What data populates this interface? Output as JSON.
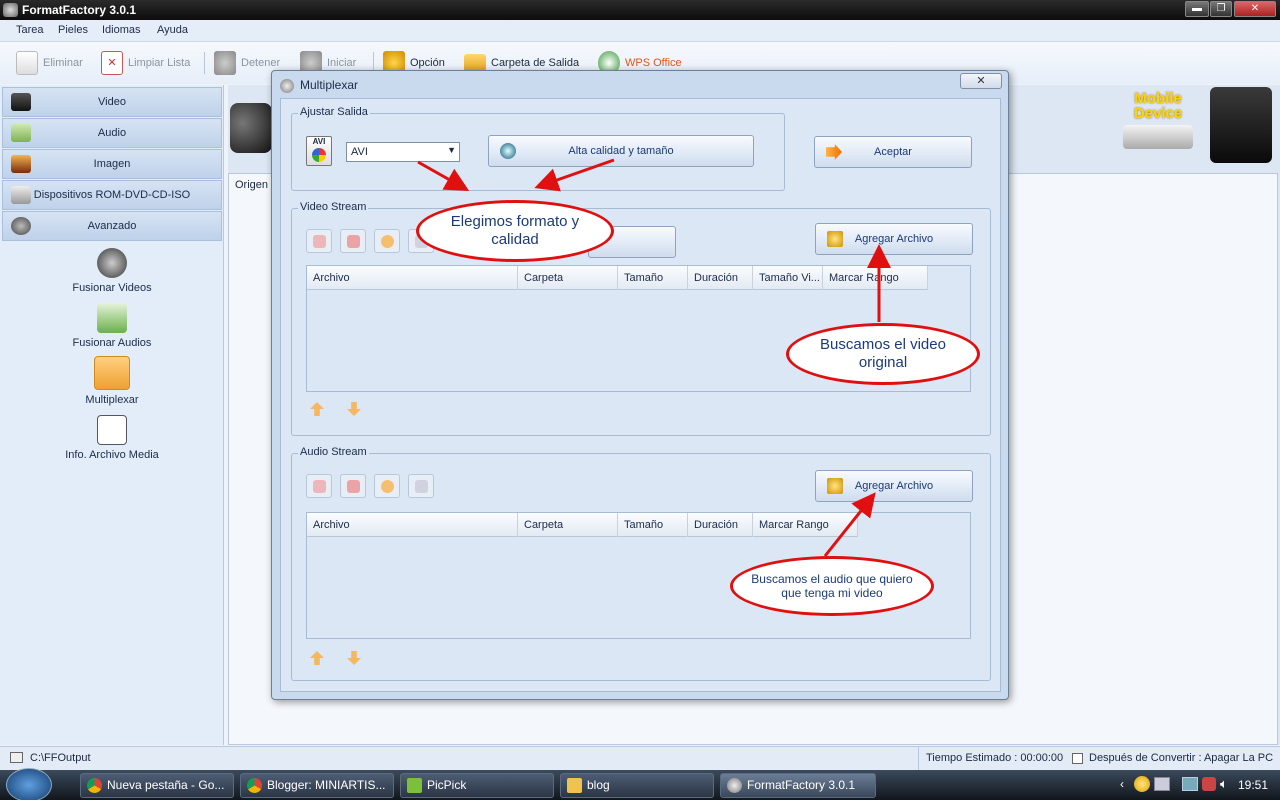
{
  "window": {
    "title": "FormatFactory 3.0.1",
    "btn_min": "▬",
    "btn_restore": "❐",
    "btn_close": "✕"
  },
  "menu": [
    "Tarea",
    "Pieles",
    "Idiomas",
    "Ayuda"
  ],
  "toolbar": {
    "eliminar": "Eliminar",
    "limpiar": "Limpiar Lista",
    "detener": "Detener",
    "iniciar": "Iniciar",
    "opcion": "Opción",
    "carpeta": "Carpeta de Salida",
    "wps": "WPS Office"
  },
  "sidebar": {
    "categories": [
      "Video",
      "Audio",
      "Imagen",
      "Dispositivos ROM-DVD-CD-ISO",
      "Avanzado"
    ],
    "items": [
      "Fusionar Videos",
      "Fusionar Audios",
      "Multiplexar",
      "Info. Archivo Media"
    ]
  },
  "main": {
    "origen_label": "Origen",
    "mobile_line1": "Mobile",
    "mobile_line2": "Device"
  },
  "statusbar": {
    "path": "C:\\FFOutput",
    "tiempo": "Tiempo Estimado : 00:00:00",
    "despues": "Después de Convertir : Apagar La PC"
  },
  "dialog": {
    "title": "Multiplexar",
    "close": "✕",
    "ajustar_label": "Ajustar Salida",
    "format_value": "AVI",
    "format_icon_text": "AVI",
    "quality_btn": "Alta calidad y tamaño",
    "aceptar_btn": "Aceptar",
    "video_stream_label": "Video Stream",
    "audio_stream_label": "Audio Stream",
    "agregar_btn": "Agregar Archivo",
    "video_columns": [
      "Archivo",
      "Carpeta",
      "Tamaño",
      "Duración",
      "Tamaño Vi...",
      "Marcar Rango"
    ],
    "audio_columns": [
      "Archivo",
      "Carpeta",
      "Tamaño",
      "Duración",
      "Marcar Rango"
    ]
  },
  "annotations": {
    "format": "Elegimos formato y calidad",
    "video": "Buscamos el video original",
    "audio": "Buscamos el audio que quiero que tenga mi video"
  },
  "taskbar": {
    "tasks": [
      "Nueva pestaña - Go...",
      "Blogger: MINIARTIS...",
      "PicPick",
      "blog",
      "FormatFactory 3.0.1"
    ],
    "clock": "19:51"
  },
  "colors": {
    "accent": "#1b3a7a",
    "callout_border": "#e01010",
    "wps": "#e0541c"
  }
}
